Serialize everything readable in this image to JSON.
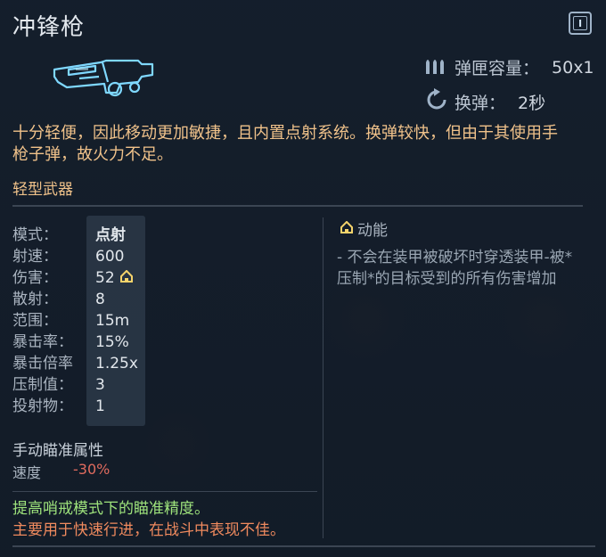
{
  "title": "冲锋枪",
  "icons": {
    "info": "info-icon",
    "weapon": "submachine-gun-icon",
    "ammo": "bullets-icon",
    "reload": "reload-icon",
    "armor_pierce": "armor-pierce-icon"
  },
  "top_stats": {
    "magazine": {
      "label": "弹匣容量：",
      "value": "50x1"
    },
    "reload": {
      "label": "换弹：",
      "value": "2秒"
    }
  },
  "description": "十分轻便，因此移动更加敏捷，且内置点射系统。换弹较快，但由于其使用手枪子弹，故火力不足。",
  "category": "轻型武器",
  "stats": [
    {
      "label": "模式：",
      "value": "点射"
    },
    {
      "label": "射速：",
      "value": "600"
    },
    {
      "label": "伤害：",
      "value": "52"
    },
    {
      "label": "散射：",
      "value": "8"
    },
    {
      "label": "范围：",
      "value": "15m"
    },
    {
      "label": "暴击率：",
      "value": "15%"
    },
    {
      "label": "暴击倍率",
      "value": "1.25x"
    },
    {
      "label": "压制值：",
      "value": "3"
    },
    {
      "label": "投射物：",
      "value": "1"
    }
  ],
  "perk": {
    "title": "动能",
    "description": "- 不会在装甲被破坏时穿透装甲-被*压制*的目标受到的所有伤害增加"
  },
  "aim": {
    "title": "手动瞄准属性",
    "speed_label": "速度",
    "speed_value": "-30%"
  },
  "pro": "提高哨戒模式下的瞄准精度。",
  "con": "主要用于快速行进，在战斗中表现不佳。",
  "colors": {
    "background": "#1a2331",
    "accent": "#f0c28a",
    "pro": "#9ee37c",
    "con": "#ef8a5e",
    "negative": "#e06b5e",
    "icon_glow": "#7fd8ff",
    "armor_icon": "#f5d36b"
  }
}
